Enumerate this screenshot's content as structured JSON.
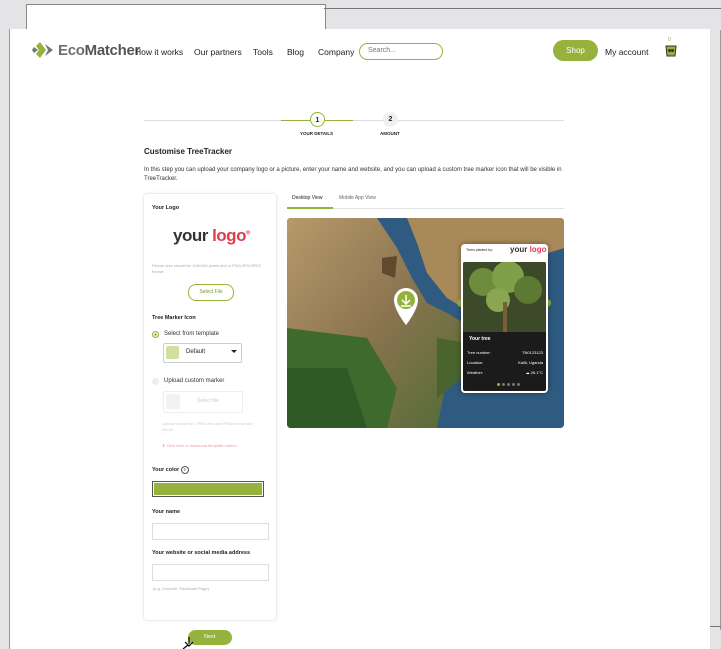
{
  "brand": {
    "name_eco": "Eco",
    "name_rest": "Matcher"
  },
  "nav": {
    "items": [
      "How it works",
      "Our partners",
      "Tools",
      "Blog",
      "Company"
    ],
    "search_placeholder": "Search...",
    "shop": "Shop",
    "account": "My account",
    "cart_count": "0"
  },
  "steps": [
    {
      "number": "1",
      "label": "YOUR DETAILS",
      "active": true
    },
    {
      "number": "2",
      "label": "AMOUNT",
      "active": false
    }
  ],
  "page": {
    "title": "Customise TreeTracker",
    "intro": "In this step you can upload your company logo or a picture, enter your name and website, and you can upload a custom tree marker icon that will be visible in TreeTracker."
  },
  "form": {
    "logo_label": "Your Logo",
    "logo_text_your": "your",
    "logo_text_logo": "logo",
    "logo_hint": "Picture size should be 100x100 pixels and in PNG/JPG/JPEG format",
    "select_file": "Select File",
    "marker_label": "Tree Marker Icon",
    "option_template": "Select from template",
    "template_default": "Default",
    "option_custom": "Upload custom marker",
    "upload_select": "Select file",
    "upload_hint": "Upload should be 1 PNG files and PNG format size 24x40",
    "download_link": "Click here to download template marker",
    "color_label": "Your color",
    "color_value": "#95b33c",
    "name_label": "Your name",
    "website_label": "Your website or social media address",
    "website_hint": "(e.g. LinkedIn, Facebook Page)",
    "next": "Next"
  },
  "preview": {
    "tabs": [
      "Desktop View",
      "Mobile App View"
    ],
    "card_planted_by": "Trees planted by:",
    "card_brand_your": "your",
    "card_brand_logo": "logo",
    "your_tree": "Your tree",
    "tree_number_label": "Tree number:",
    "tree_number_value": "TN0123123",
    "location_label": "Location:",
    "location_value": "Kaliti, Uganda",
    "weather_label": "Weather:",
    "weather_value": "26.1°C"
  }
}
